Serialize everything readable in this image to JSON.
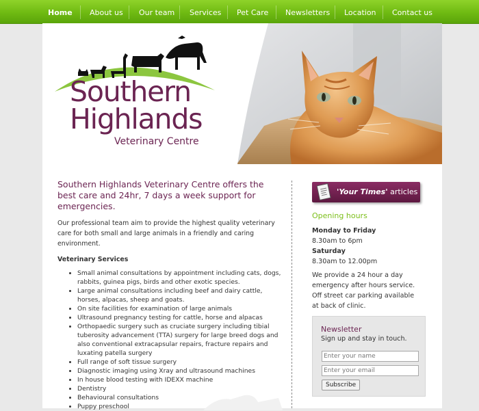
{
  "nav": {
    "items": [
      "Home",
      "About us",
      "Our team",
      "Services",
      "Pet Care",
      "Newsletters",
      "Location",
      "Contact us"
    ],
    "active_index": 0
  },
  "logo": {
    "line1": "Southern",
    "line2": "Highlands",
    "line3": "Veterinary Centre"
  },
  "main": {
    "intro": "Southern Highlands Veterinary Centre offers the best care and 24hr, 7 days a week support for emergencies.",
    "paragraph": "Our professional team aim to provide the highest quality veterinary care for both small and large animals in a friendly and caring environment.",
    "services_title": "Veterinary Services",
    "services": [
      "Small animal consultations by appointment including cats, dogs, rabbits, guinea pigs, birds and other exotic species.",
      "Large animal consultations including beef and dairy cattle, horses, alpacas, sheep and goats.",
      "On site facilities for examination of large animals",
      "Ultrasound pregnancy testing for cattle, horse and alpacas",
      "Orthopaedic surgery such as cruciate surgery including tibial tuberosity advancement (TTA) surgery for large breed dogs and also conventional extracapsular repairs, fracture repairs and luxating patella surgery",
      "Full range of soft tissue surgery",
      "Diagnostic imaging using Xray and ultrasound machines",
      "In house blood testing with IDEXX machine",
      "Dentistry",
      "Behavioural consultations",
      "Puppy preschool"
    ]
  },
  "sidebar": {
    "articles_button": {
      "emph": "'Your Times'",
      "rest": " articles"
    },
    "opening_hours_title": "Opening hours",
    "hours": [
      {
        "day": "Monday to Friday",
        "time": "8.30am to 6pm"
      },
      {
        "day": "Saturday",
        "time": "8.30am to 12.00pm"
      }
    ],
    "emergency_text": "We provide a 24 hour a day emergency after hours service. Off street car parking available at back of clinic.",
    "newsletter": {
      "title": "Newsletter",
      "subtitle": "Sign up and stay in touch.",
      "name_placeholder": "Enter your name",
      "email_placeholder": "Enter your email",
      "button_label": "Subscribe"
    }
  },
  "colors": {
    "nav_green": "#6fba12",
    "brand_purple": "#6b2452",
    "accent_green": "#7cbf1a",
    "background": "#e9e9e9"
  }
}
